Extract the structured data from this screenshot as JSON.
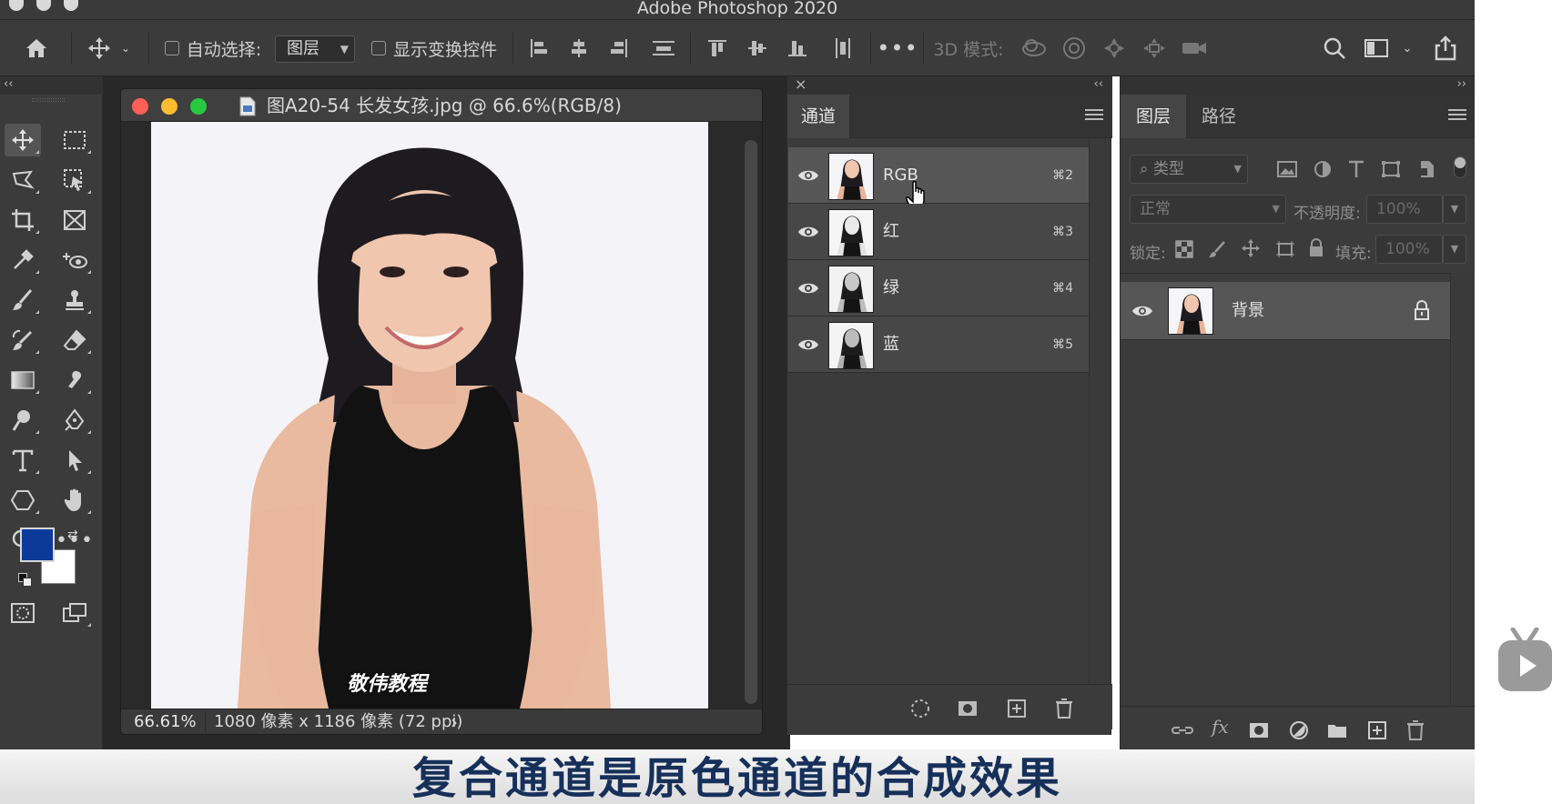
{
  "window": {
    "app_title": "Adobe Photoshop 2020"
  },
  "options_bar": {
    "auto_select_label": "自动选择:",
    "auto_select_target": "图层",
    "show_transform_label": "显示变换控件",
    "mode_3d_label": "3D 模式:"
  },
  "document": {
    "title": "图A20-54 长发女孩.jpg @ 66.6%(RGB/8)",
    "zoom": "66.61%",
    "info": "1080 像素 x 1186 像素 (72 ppi)",
    "info_arrow": "›",
    "watermark": "敬伟教程"
  },
  "toolbar": {
    "foreground_color": "#0b3b9a",
    "background_color": "#ffffff"
  },
  "channels_panel": {
    "tab_label": "通道",
    "close_glyph": "×",
    "collapse_glyph": "‹‹",
    "channels": [
      {
        "name": "RGB",
        "shortcut": "⌘2",
        "selected": true
      },
      {
        "name": "红",
        "shortcut": "⌘3",
        "selected": false
      },
      {
        "name": "绿",
        "shortcut": "⌘4",
        "selected": false
      },
      {
        "name": "蓝",
        "shortcut": "⌘5",
        "selected": false
      }
    ]
  },
  "layers_panel": {
    "tabs": [
      "图层",
      "路径"
    ],
    "expand_glyph": "››",
    "filter_label": "类型",
    "blend_mode": "正常",
    "opacity_label": "不透明度:",
    "opacity_value": "100%",
    "lock_label": "锁定:",
    "fill_label": "填充:",
    "fill_value": "100%",
    "layers": [
      {
        "name": "背景",
        "locked": true
      }
    ]
  },
  "subtitle": "复合通道是原色通道的合成效果",
  "colors": {
    "panel_bg": "#3b3b3b",
    "workspace_bg": "#282828",
    "selected_row": "#565656",
    "subtitle_text": "#16305a"
  }
}
